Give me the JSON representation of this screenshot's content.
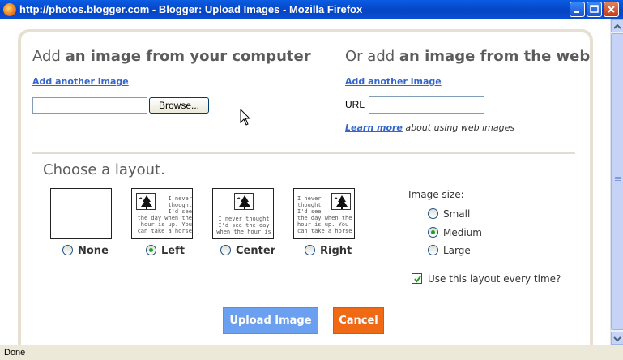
{
  "window": {
    "title": "http://photos.blogger.com - Blogger: Upload Images - Mozilla Firefox"
  },
  "computer": {
    "heading_pre": "Add ",
    "heading_bold": "an image from your computer",
    "add_another": "Add another image",
    "browse_label": "Browse..."
  },
  "web": {
    "heading_pre": "Or add ",
    "heading_bold": "an image from the web",
    "add_another": "Add another image",
    "url_label": "URL",
    "learn_more": "Learn more",
    "learn_more_suffix": " about using web images"
  },
  "layout": {
    "heading": "Choose a layout.",
    "thumb_text": "I never\nthought\nI'd see\nthe day when the\nhour is up. You\ncan take a horse",
    "thumb_text_center": "I never thought\nI'd see the day\nwhen the hour is",
    "options": [
      {
        "label": "None",
        "selected": false
      },
      {
        "label": "Left",
        "selected": true
      },
      {
        "label": "Center",
        "selected": false
      },
      {
        "label": "Right",
        "selected": false
      }
    ]
  },
  "image_size": {
    "label": "Image size:",
    "options": [
      {
        "label": "Small",
        "selected": false
      },
      {
        "label": "Medium",
        "selected": true
      },
      {
        "label": "Large",
        "selected": false
      }
    ]
  },
  "remember": {
    "label": "Use this layout every time?",
    "checked": true
  },
  "buttons": {
    "upload": "Upload Image",
    "cancel": "Cancel"
  },
  "status": {
    "text": "Done"
  },
  "colors": {
    "link": "#3366cc",
    "upload": "#6b9ff0",
    "cancel": "#f06a16",
    "radio_on": "#21a121"
  }
}
